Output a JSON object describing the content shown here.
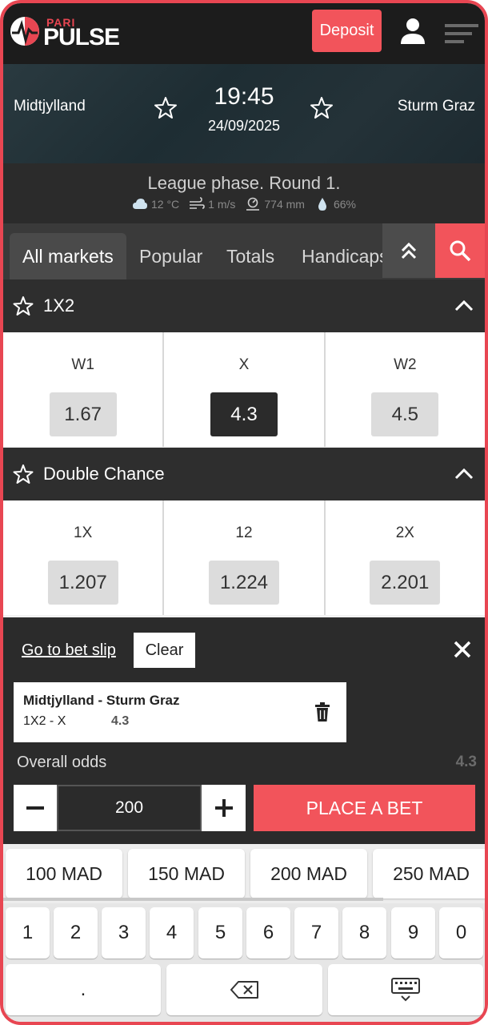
{
  "header": {
    "logo_small": "PARI",
    "logo_big": "PULSE",
    "deposit_label": "Deposit",
    "brand_color": "#f2545b"
  },
  "match": {
    "home": "Midtjylland",
    "away": "Sturm Graz",
    "time": "19:45",
    "date": "24/09/2025",
    "league": "League phase. Round 1.",
    "weather": {
      "temperature": "12 °C",
      "wind": "1 m/s",
      "pressure": "774 mm",
      "humidity": "66%"
    }
  },
  "tabs": [
    {
      "label": "All markets",
      "active": true
    },
    {
      "label": "Popular",
      "active": false
    },
    {
      "label": "Totals",
      "active": false
    },
    {
      "label": "Handicaps",
      "active": false
    }
  ],
  "markets": [
    {
      "title": "1X2",
      "outcomes": [
        {
          "label": "W1",
          "odd": "1.67",
          "selected": false
        },
        {
          "label": "X",
          "odd": "4.3",
          "selected": true
        },
        {
          "label": "W2",
          "odd": "4.5",
          "selected": false
        }
      ]
    },
    {
      "title": "Double Chance",
      "outcomes": [
        {
          "label": "1X",
          "odd": "1.207",
          "selected": false
        },
        {
          "label": "12",
          "odd": "1.224",
          "selected": false
        },
        {
          "label": "2X",
          "odd": "2.201",
          "selected": false
        }
      ]
    }
  ],
  "bet_slip": {
    "go_to_label": "Go to bet slip",
    "clear_label": "Clear",
    "selection": {
      "match": "Midtjylland - Sturm Graz",
      "market": "1X2 - X",
      "odd": "4.3"
    },
    "overall_label": "Overall odds",
    "overall_value": "4.3",
    "stake": "200",
    "place_label": "PLACE A BET"
  },
  "quick_amounts": [
    "100 MAD",
    "150 MAD",
    "200 MAD",
    "250 MAD"
  ],
  "keypad": {
    "digits": [
      "1",
      "2",
      "3",
      "4",
      "5",
      "6",
      "7",
      "8",
      "9",
      "0"
    ],
    "dot": "."
  }
}
